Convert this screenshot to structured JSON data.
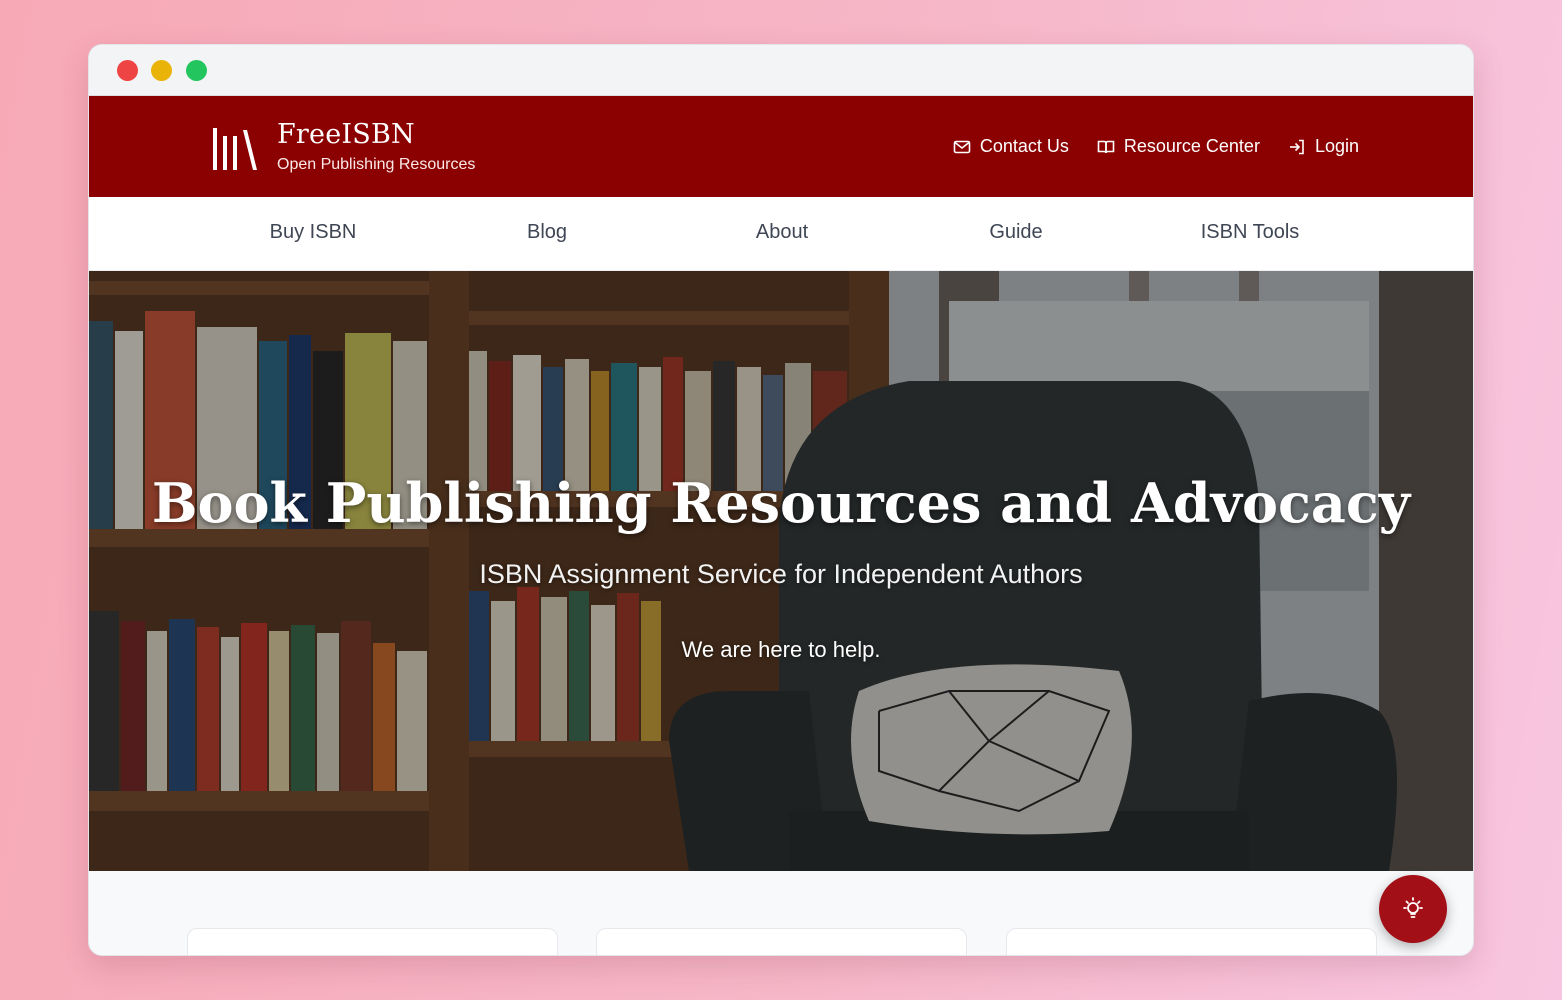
{
  "brand": {
    "name": "FreeISBN",
    "tagline": "Open Publishing Resources"
  },
  "utility_nav": [
    {
      "label": "Contact Us",
      "icon": "mail-icon"
    },
    {
      "label": "Resource Center",
      "icon": "book-open-icon"
    },
    {
      "label": "Login",
      "icon": "login-icon"
    }
  ],
  "main_nav": [
    {
      "label": "Buy ISBN"
    },
    {
      "label": "Blog"
    },
    {
      "label": "About"
    },
    {
      "label": "Guide"
    },
    {
      "label": "ISBN Tools"
    }
  ],
  "hero": {
    "title": "Book Publishing Resources and Advocacy",
    "subtitle": "ISBN Assignment Service for Independent Authors",
    "tagline": "We are here to help."
  },
  "fab": {
    "icon": "lightbulb-icon"
  },
  "colors": {
    "brand_red": "#8b0000",
    "fab_red": "#a30f16"
  }
}
